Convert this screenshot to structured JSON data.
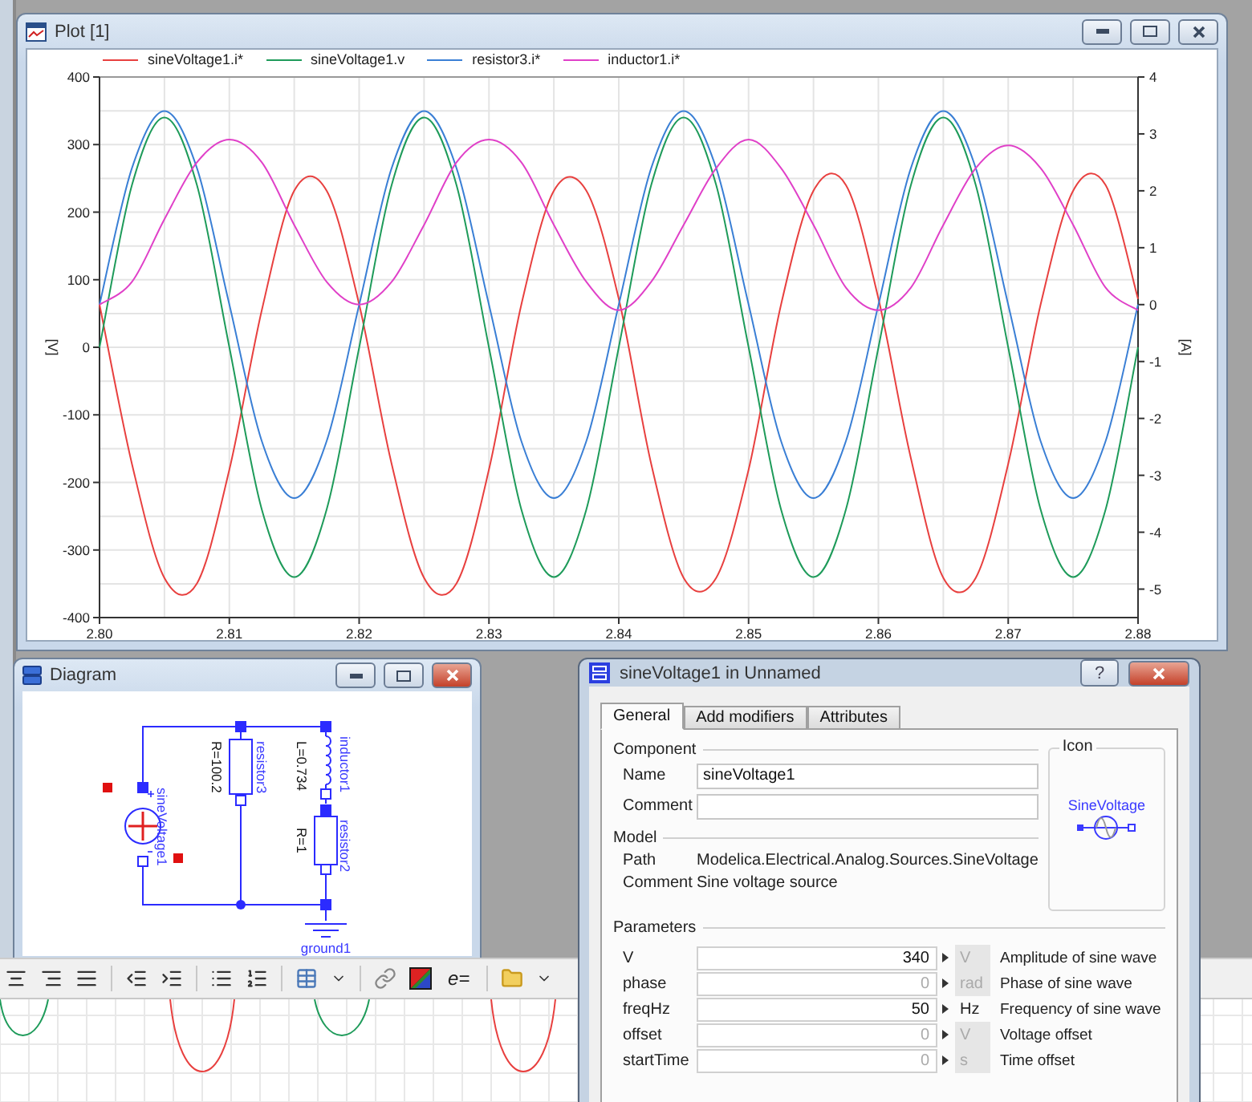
{
  "plot_window": {
    "title": "Plot [1]",
    "chart_data": {
      "type": "line",
      "grid": true,
      "ylabel": "[V]",
      "y2label": "[A]",
      "xlim": [
        2.8,
        2.88
      ],
      "ylim": [
        -400,
        400
      ],
      "y2lim": [
        -5.5,
        4
      ],
      "xticks": [
        {
          "value": 2.8,
          "label": "2.80"
        },
        {
          "value": 2.81,
          "label": "2.81"
        },
        {
          "value": 2.82,
          "label": "2.82"
        },
        {
          "value": 2.83,
          "label": "2.83"
        },
        {
          "value": 2.84,
          "label": "2.84"
        },
        {
          "value": 2.85,
          "label": "2.85"
        },
        {
          "value": 2.86,
          "label": "2.86"
        },
        {
          "value": 2.87,
          "label": "2.87"
        },
        {
          "value": 2.88,
          "label": "2.88"
        }
      ],
      "yticks": [
        -400,
        -300,
        -200,
        -100,
        0,
        100,
        200,
        300,
        400
      ],
      "y2ticks": [
        -5,
        -4,
        -3,
        -2,
        -1,
        0,
        1,
        2,
        3,
        4
      ],
      "x": [
        2.8,
        2.8025,
        2.805,
        2.8075,
        2.81,
        2.8125,
        2.815,
        2.8175,
        2.82,
        2.8225,
        2.825,
        2.8275,
        2.83,
        2.8325,
        2.835,
        2.8375,
        2.84,
        2.8425,
        2.845,
        2.8475,
        2.85,
        2.8525,
        2.855,
        2.8575,
        2.86,
        2.8625,
        2.865,
        2.8675,
        2.87,
        2.8725,
        2.875,
        2.8775,
        2.88
      ],
      "series": [
        {
          "name": "sineVoltage1.i*",
          "color": "#e8403f",
          "axis": "y2",
          "values": [
            0,
            -2.8,
            -4.8,
            -4.9,
            -2.9,
            -0.1,
            2,
            2,
            0,
            -2.8,
            -4.8,
            -4.9,
            -2.9,
            0,
            2,
            2,
            0.1,
            -2.8,
            -4.8,
            -4.8,
            -2.9,
            0,
            2,
            2.1,
            0.1,
            -2.7,
            -4.8,
            -4.8,
            -2.8,
            0,
            2,
            2.1,
            0.1
          ]
        },
        {
          "name": "sineVoltage1.v",
          "color": "#1e9b5a",
          "values": [
            0,
            240,
            340,
            240,
            0,
            -240,
            -340,
            -240,
            0,
            240,
            340,
            240,
            0,
            -240,
            -340,
            -240,
            0,
            240,
            340,
            240,
            0,
            -240,
            -340,
            -240,
            0,
            240,
            340,
            240,
            0,
            -240,
            -340,
            -240,
            0
          ]
        },
        {
          "name": "resistor3.i*",
          "color": "#3a7fd5",
          "axis": "y2",
          "values": [
            0,
            2.4,
            3.4,
            2.4,
            0,
            -2.4,
            -3.4,
            -2.4,
            0,
            2.4,
            3.4,
            2.4,
            0,
            -2.4,
            -3.4,
            -2.4,
            0,
            2.4,
            3.4,
            2.4,
            0,
            -2.4,
            -3.4,
            -2.4,
            0,
            2.4,
            3.4,
            2.4,
            0,
            -2.4,
            -3.4,
            -2.4,
            0
          ]
        },
        {
          "name": "inductor1.i*",
          "color": "#e040c8",
          "axis": "y2",
          "values": [
            0,
            0.4,
            1.5,
            2.5,
            2.9,
            2.5,
            1.4,
            0.4,
            0,
            0.4,
            1.4,
            2.5,
            2.9,
            2.5,
            1.4,
            0.4,
            -0.1,
            0.4,
            1.4,
            2.4,
            2.9,
            2.4,
            1.4,
            0.3,
            -0.1,
            0.3,
            1.4,
            2.4,
            2.8,
            2.4,
            1.4,
            0.3,
            -0.1
          ]
        }
      ]
    }
  },
  "diagram_window": {
    "title": "Diagram",
    "source": "sineVoltage1",
    "components": [
      {
        "name": "resistor3",
        "value": "R=100.2"
      },
      {
        "name": "inductor1",
        "value": "L=0.734"
      },
      {
        "name": "resistor2",
        "value": "R=1"
      }
    ],
    "ground": "ground1"
  },
  "toolbar": {
    "equation_button": "e="
  },
  "dialog": {
    "title": "sineVoltage1 in Unnamed",
    "help": "?",
    "tabs": [
      {
        "label": "General",
        "selected": true
      },
      {
        "label": "Add modifiers",
        "selected": false
      },
      {
        "label": "Attributes",
        "selected": false
      }
    ],
    "component": {
      "heading": "Component",
      "fields": [
        {
          "label": "Name",
          "value": "sineVoltage1"
        },
        {
          "label": "Comment"
        }
      ]
    },
    "icon": {
      "heading": "Icon",
      "label": "SineVoltage"
    },
    "model": {
      "heading": "Model",
      "rows": [
        {
          "label": "Path",
          "value": "Modelica.Electrical.Analog.Sources.SineVoltage"
        },
        {
          "label": "Comment",
          "value": "Sine voltage source"
        }
      ]
    },
    "parameters": {
      "heading": "Parameters",
      "rows": [
        {
          "name": "V",
          "value": "340",
          "default": false,
          "unit": "V",
          "unit_fixed": true,
          "description": "Amplitude of sine wave"
        },
        {
          "name": "phase",
          "value": "0",
          "default": true,
          "unit": "rad",
          "unit_fixed": true,
          "description": "Phase of sine wave"
        },
        {
          "name": "freqHz",
          "value": "50",
          "default": false,
          "unit": "Hz",
          "unit_fixed": false,
          "description": "Frequency of sine wave"
        },
        {
          "name": "offset",
          "value": "0",
          "default": true,
          "unit": "V",
          "unit_fixed": true,
          "description": "Voltage offset"
        },
        {
          "name": "startTime",
          "value": "0",
          "default": true,
          "unit": "s",
          "unit_fixed": true,
          "description": "Time offset"
        }
      ]
    }
  }
}
